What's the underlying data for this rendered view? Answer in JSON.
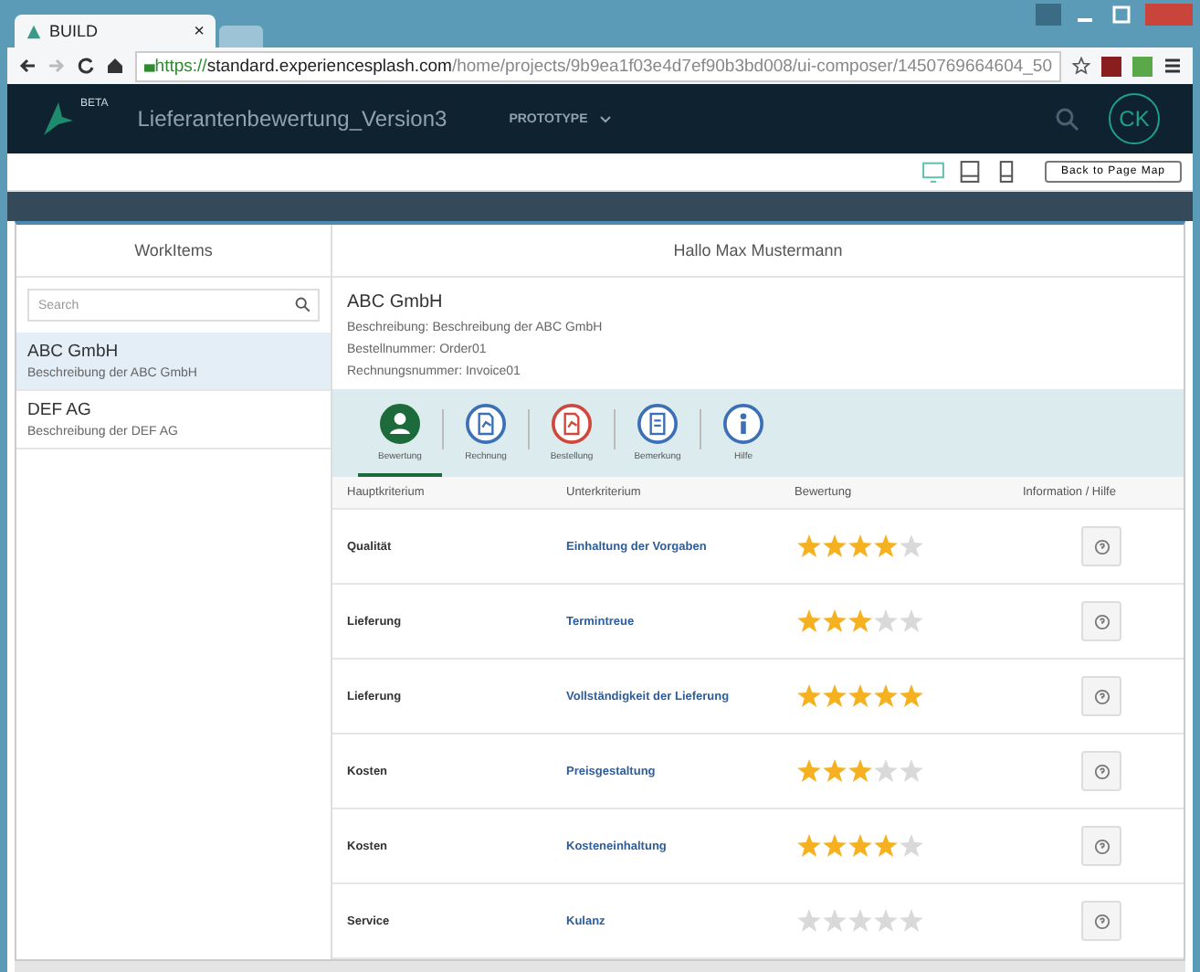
{
  "browser": {
    "tab": {
      "title": "BUILD",
      "close": "×"
    },
    "url": {
      "scheme": "https://",
      "host": "standard.experiencesplash.com",
      "path": "/home/projects/9b9ea1f03e4d7ef90b3bd008/ui-composer/1450769664604_50"
    }
  },
  "header": {
    "badge": "BETA",
    "project": "Lieferantenbewertung_Version3",
    "mode": "PROTOTYPE",
    "avatar": "CK"
  },
  "toolbar": {
    "devices": [
      {
        "kind": "desktop",
        "selected": true
      },
      {
        "kind": "tablet",
        "selected": false
      },
      {
        "kind": "phone",
        "selected": false
      }
    ],
    "back_button": "Back to Page Map"
  },
  "sidebar": {
    "title": "WorkItems",
    "search": {
      "placeholder": "Search"
    },
    "items": [
      {
        "title": "ABC GmbH",
        "subtitle": "Beschreibung der ABC GmbH",
        "selected": true
      },
      {
        "title": "DEF AG",
        "subtitle": "Beschreibung der DEF AG",
        "selected": false
      }
    ]
  },
  "detail": {
    "greeting": "Hallo Max Mustermann",
    "title": "ABC GmbH",
    "fields": [
      "Beschreibung: Beschreibung der ABC GmbH",
      "Bestellnummer: Order01",
      "Rechnungsnummer: Invoice01"
    ],
    "tabs": [
      {
        "kind": "person",
        "label": "Bewertung",
        "color": "#1d6b3a",
        "selected": true
      },
      {
        "kind": "invoice",
        "label": "Rechnung",
        "color": "#3b6fb6",
        "selected": false
      },
      {
        "kind": "order",
        "label": "Bestellung",
        "color": "#d0473c",
        "selected": false
      },
      {
        "kind": "note",
        "label": "Bemerkung",
        "color": "#3b6fb6",
        "selected": false
      },
      {
        "kind": "info",
        "label": "Hilfe",
        "color": "#3b6fb6",
        "selected": false
      }
    ],
    "table": {
      "columns": [
        "Hauptkriterium",
        "Unterkriterium",
        "Bewertung",
        "Information / Hilfe"
      ],
      "rows": [
        {
          "main": "Qualität",
          "sub": "Einhaltung der Vorgaben",
          "stars": 4
        },
        {
          "main": "Lieferung",
          "sub": "Termintreue",
          "stars": 3
        },
        {
          "main": "Lieferung",
          "sub": "Vollständigkeit der Lieferung",
          "stars": 5
        },
        {
          "main": "Kosten",
          "sub": "Preisgestaltung",
          "stars": 3
        },
        {
          "main": "Kosten",
          "sub": "Kosteneinhaltung",
          "stars": 4
        },
        {
          "main": "Service",
          "sub": "Kulanz",
          "stars": 0
        }
      ]
    }
  }
}
